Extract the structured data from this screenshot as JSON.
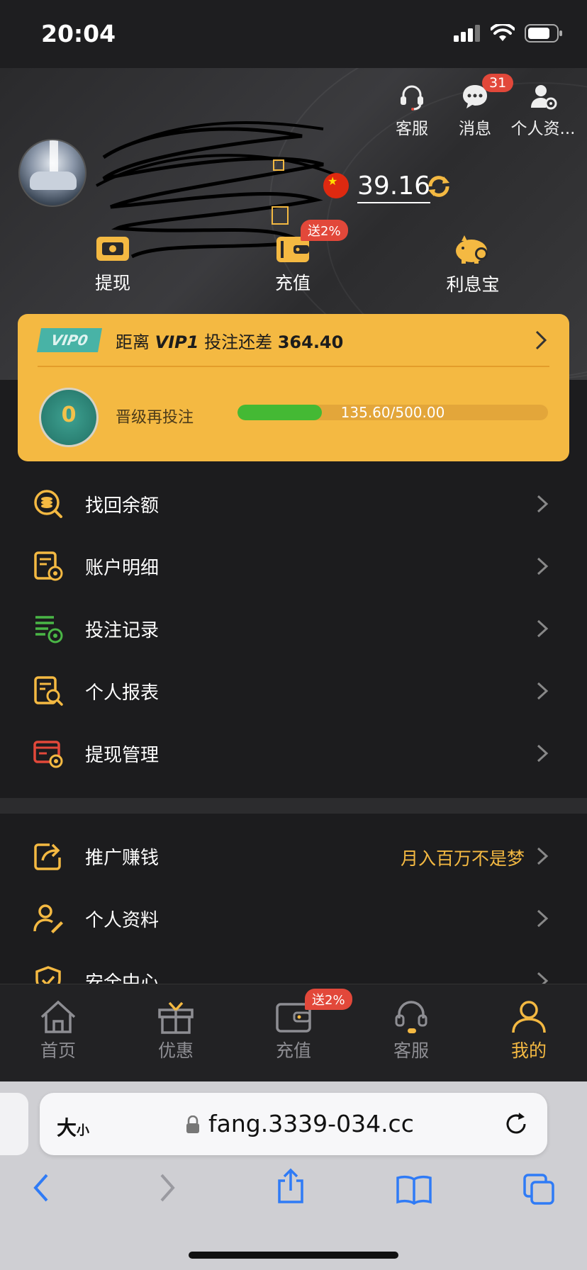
{
  "status_bar": {
    "time": "20:04"
  },
  "header": {
    "top_actions": [
      {
        "label": "客服",
        "icon": "headset-icon"
      },
      {
        "label": "消息",
        "icon": "chat-bubble-icon",
        "badge": "31"
      },
      {
        "label": "个人资...",
        "icon": "user-settings-icon"
      }
    ],
    "balance": "39.16",
    "quick_actions": [
      {
        "label": "提现",
        "icon": "cash-icon"
      },
      {
        "label": "充值",
        "icon": "wallet-icon",
        "badge": "送2%"
      },
      {
        "label": "利息宝",
        "icon": "piggy-bank-icon"
      }
    ]
  },
  "vip": {
    "tag": "VIP0",
    "line_prefix": "距离",
    "next_level": "VIP1",
    "line_middle": "投注还差",
    "remaining": "364.40",
    "medal_level": "0",
    "upgrade_label": "晋级再投注",
    "progress_text": "135.60/500.00",
    "progress_fraction": 0.2712
  },
  "menu_group1": [
    {
      "label": "找回余额",
      "icon": "coin-search-icon"
    },
    {
      "label": "账户明细",
      "icon": "account-detail-icon"
    },
    {
      "label": "投注记录",
      "icon": "bet-record-icon"
    },
    {
      "label": "个人报表",
      "icon": "report-search-icon"
    },
    {
      "label": "提现管理",
      "icon": "withdraw-settings-icon"
    }
  ],
  "menu_group2": [
    {
      "label": "推广赚钱",
      "icon": "share-icon",
      "extra": "月入百万不是梦"
    },
    {
      "label": "个人资料",
      "icon": "profile-edit-icon"
    },
    {
      "label": "安全中心",
      "icon": "shield-check-icon"
    }
  ],
  "tabbar": {
    "tabs": [
      {
        "label": "首页",
        "icon": "home-icon"
      },
      {
        "label": "优惠",
        "icon": "gift-icon"
      },
      {
        "label": "充值",
        "icon": "wallet-icon",
        "badge": "送2%"
      },
      {
        "label": "客服",
        "icon": "headset-icon"
      },
      {
        "label": "我的",
        "icon": "person-icon"
      }
    ]
  },
  "safari": {
    "text_size_big": "大",
    "text_size_small": "小",
    "url": "fang.3339-034.cc"
  },
  "colors": {
    "accent": "#f4b942",
    "badge": "#e2483a",
    "progress": "#44b934"
  }
}
